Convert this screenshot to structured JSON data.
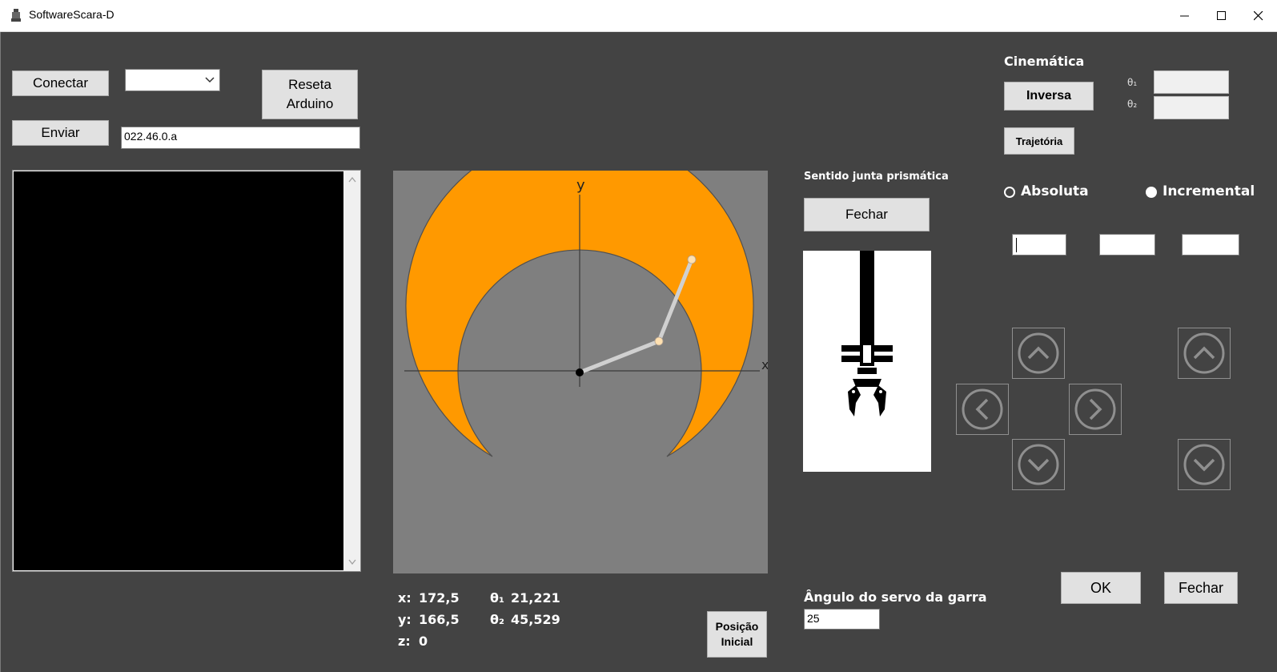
{
  "window": {
    "title": "SoftwareScara-D",
    "minimize_icon": "minimize-icon",
    "maximize_icon": "maximize-icon",
    "close_icon": "close-icon"
  },
  "serial": {
    "connect_label": "Conectar",
    "port_selected": "",
    "reset_label_line1": "Reseta",
    "reset_label_line2": "Arduino",
    "send_label": "Enviar",
    "command_value": "022.46.0.a",
    "console_text": ""
  },
  "workspace": {
    "y_axis": "y",
    "x_axis": "x",
    "colors": {
      "background": "#7f7f7f",
      "reach_area": "#ff9900",
      "arm": "#d0d0d0",
      "joint": "#ffe0b0"
    }
  },
  "readout": {
    "x_label": "x:",
    "x_value": "172,5",
    "y_label": "y:",
    "y_value": "166,5",
    "z_label": "z:",
    "z_value": "0",
    "t1_label": "θ₁",
    "t1_value": "21,221",
    "t2_label": "θ₂",
    "t2_value": "45,529"
  },
  "home_button": {
    "line1": "Posição",
    "line2": "Inicial"
  },
  "prismatic": {
    "label": "Sentido junta prismática",
    "button_label": "Fechar",
    "image_icon": "gripper-icon"
  },
  "servo": {
    "label": "Ângulo do servo da garra",
    "value": "25"
  },
  "kinematics": {
    "title": "Cinemática",
    "inverse_label": "Inversa",
    "trajectory_label": "Trajetória",
    "t1_label": "θ₁",
    "t2_label": "θ₂",
    "t1_value": "",
    "t2_value": "",
    "absolute_label": "Absoluta",
    "incremental_label": "Incremental",
    "absolute_selected": false,
    "incremental_selected": true,
    "input1": "",
    "input2": "",
    "input3": ""
  },
  "jog": {
    "up_icon": "arrow-up-icon",
    "down_icon": "arrow-down-icon",
    "left_icon": "arrow-left-icon",
    "right_icon": "arrow-right-icon"
  },
  "actions": {
    "ok_label": "OK",
    "close_label": "Fechar"
  }
}
